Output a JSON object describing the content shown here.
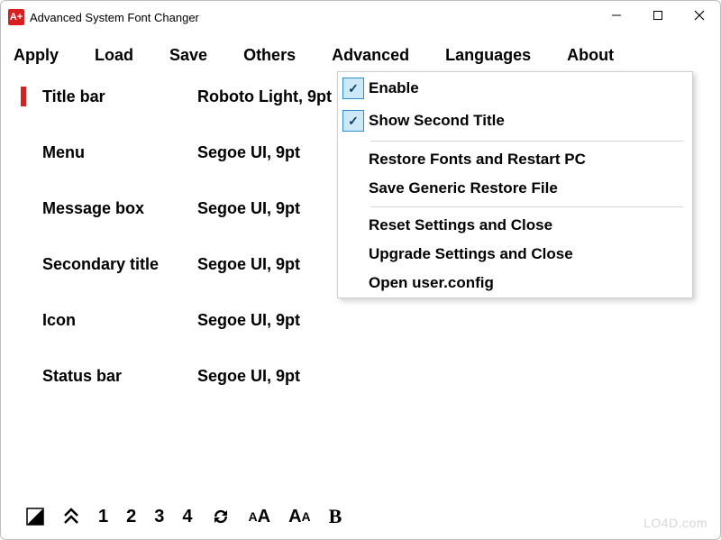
{
  "window": {
    "title": "Advanced System Font Changer",
    "app_icon_text": "A+"
  },
  "menubar": {
    "items": [
      {
        "label": "Apply"
      },
      {
        "label": "Load"
      },
      {
        "label": "Save"
      },
      {
        "label": "Others"
      },
      {
        "label": "Advanced"
      },
      {
        "label": "Languages"
      },
      {
        "label": "About"
      }
    ],
    "open_index": 4
  },
  "rows": [
    {
      "label": "Title bar",
      "value": "Roboto Light, 9pt",
      "active": true
    },
    {
      "label": "Menu",
      "value": "Segoe UI, 9pt",
      "active": false
    },
    {
      "label": "Message box",
      "value": "Segoe UI, 9pt",
      "active": false
    },
    {
      "label": "Secondary title",
      "value": "Segoe UI, 9pt",
      "active": false
    },
    {
      "label": "Icon",
      "value": "Segoe UI, 9pt",
      "active": false
    },
    {
      "label": "Status bar",
      "value": "Segoe UI, 9pt",
      "active": false
    }
  ],
  "dropdown": {
    "groups": [
      [
        {
          "label": "Enable",
          "checked": true
        },
        {
          "label": "Show Second Title",
          "checked": true
        }
      ],
      [
        {
          "label": "Restore Fonts and Restart PC",
          "checked": false
        },
        {
          "label": "Save Generic Restore File",
          "checked": false
        }
      ],
      [
        {
          "label": "Reset Settings and Close",
          "checked": false
        },
        {
          "label": "Upgrade Settings and Close",
          "checked": false
        },
        {
          "label": "Open user.config",
          "checked": false
        }
      ]
    ]
  },
  "toolbar": {
    "items": [
      {
        "name": "contrast-icon"
      },
      {
        "name": "double-up-icon"
      },
      {
        "name": "num-1",
        "label": "1"
      },
      {
        "name": "num-2",
        "label": "2"
      },
      {
        "name": "num-3",
        "label": "3"
      },
      {
        "name": "num-4",
        "label": "4"
      },
      {
        "name": "refresh-icon"
      },
      {
        "name": "font-size-icon"
      },
      {
        "name": "font-case-icon"
      },
      {
        "name": "bold-icon",
        "label": "B"
      }
    ]
  },
  "watermark": "LO4D.com"
}
